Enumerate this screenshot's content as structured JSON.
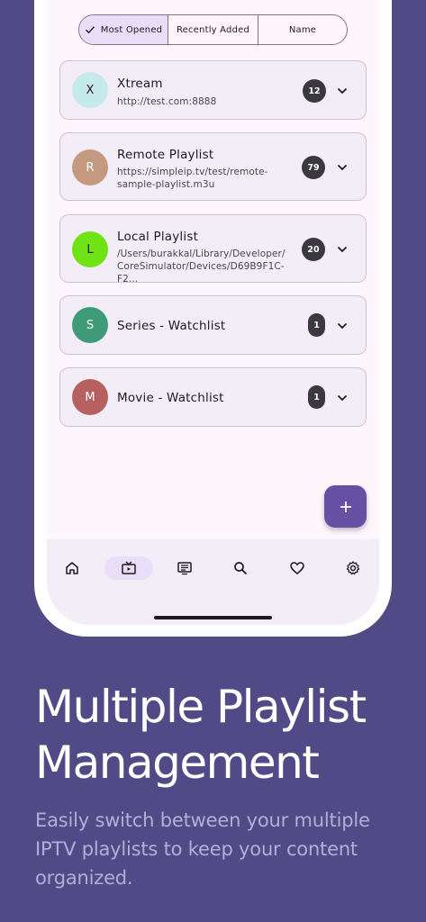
{
  "tabs": [
    {
      "label": "Most Opened",
      "active": true
    },
    {
      "label": "Recently Added",
      "active": false
    },
    {
      "label": "Name",
      "active": false
    }
  ],
  "playlists": [
    {
      "initial": "X",
      "title": "Xtream",
      "url": "http://test.com:8888",
      "count": "12",
      "avatar_color": "#c6e9ec"
    },
    {
      "initial": "R",
      "title": "Remote Playlist",
      "url": "https://simpleip.tv/test/remote-sample-playlist.m3u",
      "url_line1": "https://simpleip.tv/test/remote-",
      "url_line2": "sample-playlist.m3u",
      "count": "79",
      "avatar_color": "#c39a80"
    },
    {
      "initial": "L",
      "title": "Local Playlist",
      "url_line1": "/Users/burakkal/Library/Developer/",
      "url_line2": "CoreSimulator/Devices/D69B9F1C-F2...",
      "count": "20",
      "avatar_color": "#70e314"
    },
    {
      "initial": "S",
      "title": "Series - Watchlist",
      "count": "1",
      "avatar_color": "#3f9a78"
    },
    {
      "initial": "M",
      "title": "Movie - Watchlist",
      "count": "1",
      "avatar_color": "#b6615f"
    }
  ],
  "fab_label": "+",
  "nav": [
    "home-icon",
    "tv-icon",
    "list-icon",
    "search-icon",
    "heart-icon",
    "settings-icon"
  ],
  "marketing": {
    "headline": "Multiple Playlist Management",
    "headline_line1": "Multiple Playlist",
    "headline_line2": "Management",
    "subhead_line1": "Easily switch between your multiple",
    "subhead_line2": "IPTV playlists to keep your content",
    "subhead_line3": "organized."
  },
  "colors": {
    "background": "#524a86",
    "accent": "#6750a4",
    "active_pill": "#e8def8"
  }
}
